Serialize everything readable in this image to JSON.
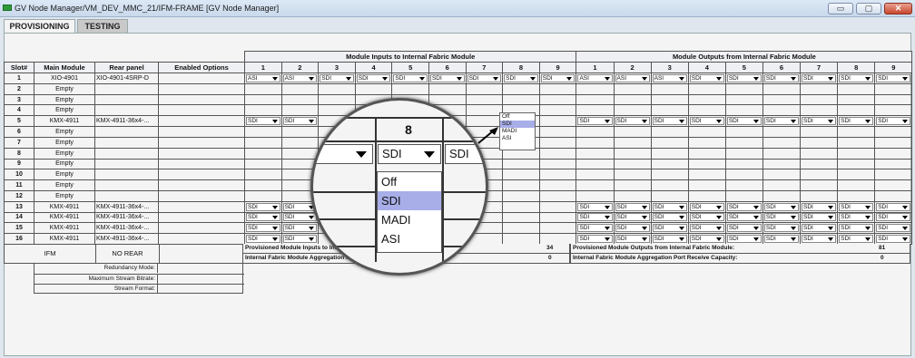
{
  "window": {
    "title": "GV Node Manager/VM_DEV_MMC_21/IFM-FRAME [GV Node Manager]",
    "minimize_icon": "minimize-icon",
    "maximize_icon": "maximize-icon",
    "close_icon": "close-icon"
  },
  "tabs": [
    {
      "label": "PROVISIONING",
      "active": true
    },
    {
      "label": "TESTING",
      "active": false
    }
  ],
  "table": {
    "group_inputs": "Module Inputs to Internal Fabric Module",
    "group_outputs": "Module Outputs from Internal Fabric Module",
    "col_slot": "Slot#",
    "col_main": "Main Module",
    "col_rear": "Rear panel",
    "col_options": "Enabled Options",
    "in_cols": [
      "1",
      "2",
      "3",
      "4",
      "5",
      "6",
      "7",
      "8",
      "9"
    ],
    "out_cols": [
      "1",
      "2",
      "3",
      "4",
      "5",
      "6",
      "7",
      "8",
      "9"
    ],
    "rows": [
      {
        "slot": "1",
        "main": "XIO-4901",
        "rear": "XIO-4901-4SRP-D",
        "inputs": [
          "ASI",
          "ASI",
          "SDI",
          "SDI",
          "SDI",
          "SDI",
          "SDI",
          "SDI",
          "SDI"
        ],
        "outputs": [
          "ASI",
          "ASI",
          "ASI",
          "SDI",
          "SDI",
          "SDI",
          "SDI",
          "SDI",
          "SDI"
        ]
      },
      {
        "slot": "2",
        "main": "Empty",
        "rear": "",
        "inputs": [],
        "outputs": []
      },
      {
        "slot": "3",
        "main": "Empty",
        "rear": "",
        "inputs": [],
        "outputs": []
      },
      {
        "slot": "4",
        "main": "Empty",
        "rear": "",
        "inputs": [],
        "outputs": []
      },
      {
        "slot": "5",
        "main": "KMX-4911",
        "rear": "KMX-4911-36x4-...",
        "inputs": [
          "SDI",
          "SDI"
        ],
        "outputs": [
          "SDI",
          "SDI",
          "SDI",
          "SDI",
          "SDI",
          "SDI",
          "SDI",
          "SDI",
          "SDI"
        ]
      },
      {
        "slot": "6",
        "main": "Empty",
        "rear": "",
        "inputs": [],
        "outputs": []
      },
      {
        "slot": "7",
        "main": "Empty",
        "rear": "",
        "inputs": [],
        "outputs": []
      },
      {
        "slot": "8",
        "main": "Empty",
        "rear": "",
        "inputs": [],
        "outputs": []
      },
      {
        "slot": "9",
        "main": "Empty",
        "rear": "",
        "inputs": [],
        "outputs": []
      },
      {
        "slot": "10",
        "main": "Empty",
        "rear": "",
        "inputs": [],
        "outputs": []
      },
      {
        "slot": "11",
        "main": "Empty",
        "rear": "",
        "inputs": [],
        "outputs": []
      },
      {
        "slot": "12",
        "main": "Empty",
        "rear": "",
        "inputs": [],
        "outputs": []
      },
      {
        "slot": "13",
        "main": "KMX-4911",
        "rear": "KMX-4911-36x4-...",
        "inputs": [
          "SDI",
          "SDI"
        ],
        "outputs": [
          "SDI",
          "SDI",
          "SDI",
          "SDI",
          "SDI",
          "SDI",
          "SDI",
          "SDI",
          "SDI"
        ]
      },
      {
        "slot": "14",
        "main": "KMX-4911",
        "rear": "KMX-4911-36x4-...",
        "inputs": [
          "SDI",
          "SDI"
        ],
        "outputs": [
          "SDI",
          "SDI",
          "SDI",
          "SDI",
          "SDI",
          "SDI",
          "SDI",
          "SDI",
          "SDI"
        ]
      },
      {
        "slot": "15",
        "main": "KMX-4911",
        "rear": "KMX-4911-36x4-...",
        "inputs": [
          "SDI",
          "SDI"
        ],
        "outputs": [
          "SDI",
          "SDI",
          "SDI",
          "SDI",
          "SDI",
          "SDI",
          "SDI",
          "SDI",
          "SDI"
        ]
      },
      {
        "slot": "16",
        "main": "KMX-4911",
        "rear": "KMX-4911-36x4-...",
        "inputs": [
          "SDI",
          "SDI"
        ],
        "outputs": [
          "SDI",
          "SDI",
          "SDI",
          "SDI",
          "SDI",
          "SDI",
          "SDI",
          "SDI",
          "SDI"
        ]
      }
    ]
  },
  "summary": {
    "in_provisioned_label": "Provisioned Module Inputs to Internal Fabric Module:",
    "in_provisioned_value": "34",
    "in_capacity_label": "Internal Fabric Module Aggregation Port Transmit Capacity:",
    "in_capacity_value": "0",
    "out_provisioned_label": "Provisioned Module Outputs from Internal Fabric Module:",
    "out_provisioned_value": "81",
    "out_capacity_label": "Internal Fabric Module Aggregation Port Receive Capacity:",
    "out_capacity_value": "0"
  },
  "ifm": {
    "main": "IFM",
    "rear": "NO REAR"
  },
  "options": [
    {
      "label": "Redundancy Mode:"
    },
    {
      "label": "Maximum Stream Bitrate:"
    },
    {
      "label": "Stream Format:"
    }
  ],
  "dropdown": {
    "options": [
      "Off",
      "SDI",
      "MADI",
      "ASI"
    ],
    "highlighted": "SDI"
  },
  "magnifier": {
    "header": "8",
    "left_value": "SDI",
    "right_value": "SDI",
    "options": [
      "Off",
      "SDI",
      "MADI",
      "ASI"
    ],
    "highlighted": "SDI"
  },
  "colors": {
    "highlight": "#a8aee8",
    "close_button": "#c8472d",
    "app_icon": "#2f9a3a"
  }
}
